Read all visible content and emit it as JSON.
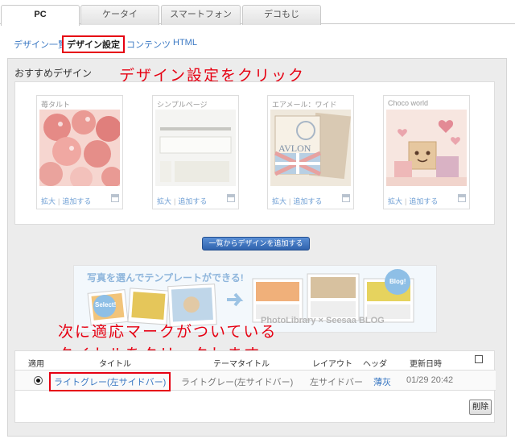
{
  "tabs": [
    {
      "label": "PC",
      "active": true
    },
    {
      "label": "ケータイ",
      "active": false
    },
    {
      "label": "スマートフォン",
      "active": false
    },
    {
      "label": "デコもじ",
      "active": false
    }
  ],
  "subnav": {
    "design_list": "デザイン一覧",
    "design_settings": "デザイン設定",
    "contents": "コンテンツ",
    "html": "HTML"
  },
  "recommended": {
    "title": "おすすめデザイン",
    "cards": [
      {
        "name": "苺タルト",
        "enlarge": "拡大",
        "add": "追加する"
      },
      {
        "name": "シンプルページ",
        "enlarge": "拡大",
        "add": "追加する"
      },
      {
        "name": "エアメール：ワイド",
        "enlarge": "拡大",
        "add": "追加する"
      },
      {
        "name": "Choco world",
        "enlarge": "拡大",
        "add": "追加する"
      }
    ],
    "add_from_list_button": "一覧からデザインを追加する"
  },
  "banner": {
    "headline": "写真を選んでテンプレートができる!",
    "badge_left": "Select!",
    "badge_right": "Blog!",
    "logo_text": "PhotoLibrary × Seesaa BLOG"
  },
  "annotations": {
    "top": "デザイン設定をクリック",
    "bottom_line1": "次に適応マークがついている",
    "bottom_line2": "タイトルをクリックします。"
  },
  "table": {
    "headers": {
      "apply": "適用",
      "title": "タイトル",
      "theme_title": "テーマタイトル",
      "layout": "レイアウト",
      "header": "ヘッダ",
      "updated": "更新日時"
    },
    "rows": [
      {
        "title": "ライトグレー(左サイドバー)",
        "theme_title": "ライトグレー(左サイドバー)",
        "layout": "左サイドバー",
        "header": "薄灰",
        "updated": "01/29 20:42",
        "applied": true
      }
    ],
    "delete_button": "削除"
  },
  "colors": {
    "accent_red": "#e60012",
    "link_blue": "#3a78c3",
    "button_blue": "#2f62ad"
  }
}
